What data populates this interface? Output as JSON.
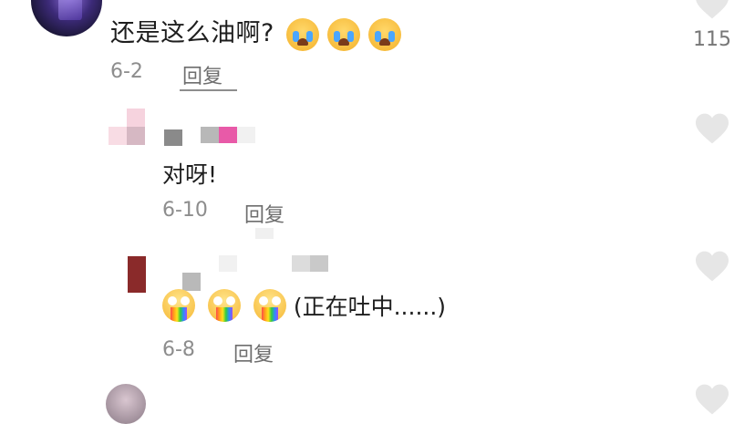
{
  "comments": [
    {
      "text": "还是这么油啊?",
      "emojis": [
        "loudly-crying-face",
        "loudly-crying-face",
        "loudly-crying-face"
      ],
      "date": "6-2",
      "reply_label": "回复",
      "like_count": "115"
    }
  ],
  "replies": [
    {
      "text": "对呀!",
      "date": "6-10",
      "reply_label": "回复"
    },
    {
      "text": "(正在吐中......)",
      "emojis": [
        "vomiting-face",
        "vomiting-face",
        "vomiting-face"
      ],
      "date": "6-8",
      "reply_label": "回复"
    }
  ],
  "colors": {
    "heart": "#e6e6e6",
    "date_text": "#8d8d8d",
    "reply_text": "#6e6e6e",
    "mosaic_pink": "#e85aa8"
  }
}
